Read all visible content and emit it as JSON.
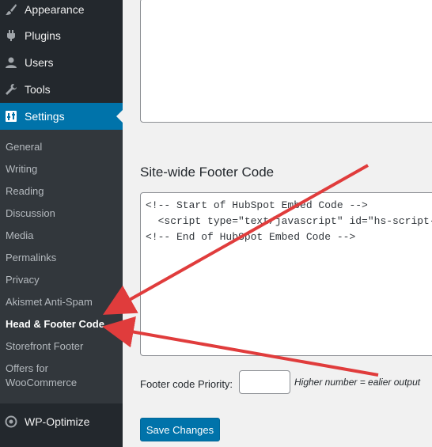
{
  "sidebar": {
    "menu": [
      {
        "label": "Appearance",
        "icon": "paintbrush-icon"
      },
      {
        "label": "Plugins",
        "icon": "plugin-icon"
      },
      {
        "label": "Users",
        "icon": "user-icon"
      },
      {
        "label": "Tools",
        "icon": "wrench-icon"
      },
      {
        "label": "Settings",
        "icon": "settings-icon"
      }
    ],
    "submenu": [
      "General",
      "Writing",
      "Reading",
      "Discussion",
      "Media",
      "Permalinks",
      "Privacy",
      "Akismet Anti-Spam",
      "Head & Footer Code",
      "Storefront Footer",
      "Offers for",
      "WooCommerce"
    ],
    "bottom_menu": [
      {
        "label": "WP-Optimize",
        "icon": "wp-optimize-icon"
      }
    ]
  },
  "main": {
    "footer_section_title": "Site-wide Footer Code",
    "footer_code_lines": [
      "<!-- Start of HubSpot Embed Code -->",
      "  <script type=\"text/javascript\" id=\"hs-script-",
      "<!-- End of HubSpot Embed Code -->"
    ],
    "priority_label": "Footer code Priority:",
    "priority_value": "",
    "priority_hint": "Higher number = ealier output",
    "save_label": "Save Changes"
  },
  "colors": {
    "sidebar_bg": "#23282d",
    "submenu_bg": "#32373c",
    "accent": "#0073aa",
    "annotation_arrow": "#e03c3c"
  }
}
